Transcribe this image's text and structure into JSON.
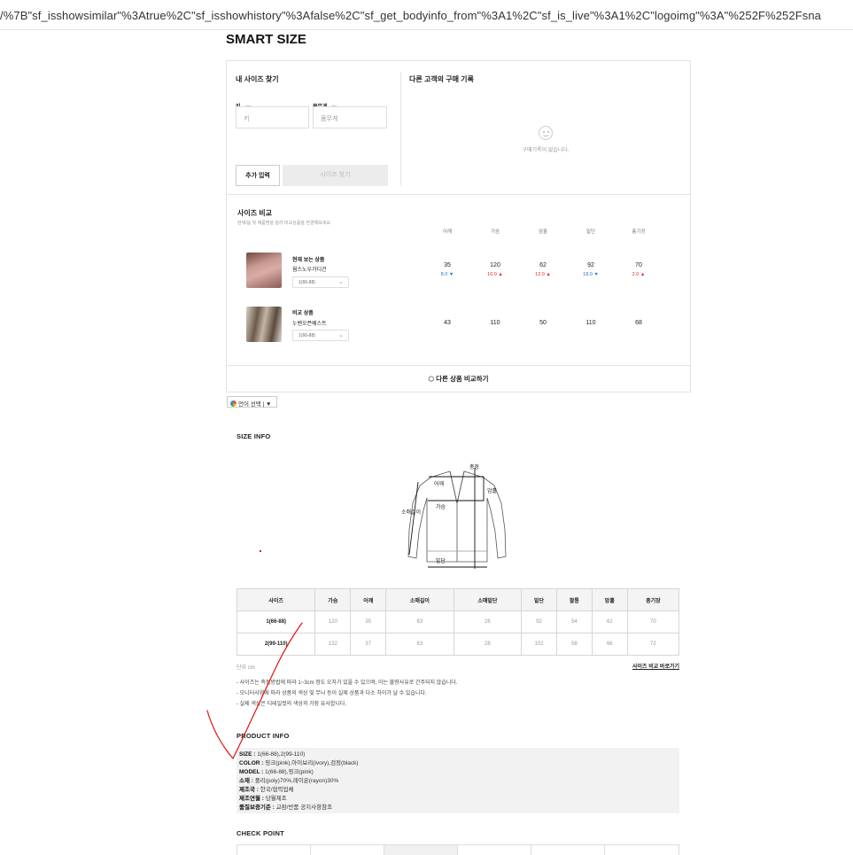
{
  "browser": {
    "url": "/%7B\"sf_isshowsimilar\"%3Atrue%2C\"sf_isshowhistory\"%3Afalse%2C\"sf_get_bodyinfo_from\"%3A1%2C\"sf_is_live\"%3A1%2C\"logoimg\"%3A\"%252F%252Fsna"
  },
  "page_title": "SMART SIZE",
  "find_size": {
    "heading": "내 사이즈 찾기",
    "height_label": "키",
    "height_unit": "cm",
    "weight_label": "몸무게",
    "weight_unit": "kg",
    "height_placeholder": "키",
    "weight_placeholder": "몸무게",
    "extra_button": "추가 입력",
    "find_button": "사이즈 찾기"
  },
  "history": {
    "heading": "다른 고객의 구매 기록",
    "empty_text": "구매기록이 없습니다."
  },
  "compare": {
    "heading": "사이즈 비교",
    "subtext": "현재/옵 및 제품명을 눌러 비교상품을 변경해보세요.",
    "columns": [
      "어깨",
      "가슴",
      "암홀",
      "밑단",
      "총기장"
    ],
    "current": {
      "tag": "현재 보는 상품",
      "name": "웜스노우가디건",
      "option": "1(66-88)",
      "values": [
        "35",
        "120",
        "62",
        "92",
        "70"
      ],
      "diffs": [
        "8.0",
        "10.0",
        "12.0",
        "18.0",
        "2.0"
      ],
      "diff_dir": [
        "down",
        "up",
        "up",
        "down",
        "up"
      ]
    },
    "other": {
      "tag": "비교 상품",
      "name": "누벤오픈베스트",
      "option": "1(66-88)",
      "values": [
        "43",
        "110",
        "50",
        "110",
        "68"
      ]
    },
    "compare_other_button": "다른 상품 비교하기"
  },
  "language": {
    "label": "언어 선택",
    "arrow": "▼"
  },
  "size_info": {
    "heading": "SIZE INFO",
    "diagram_labels": {
      "total_length": "총장",
      "shoulder": "어깨",
      "armhole": "암홀",
      "sleeve": "소매길이",
      "chest": "가슴",
      "hem": "밑단"
    },
    "table_headers": [
      "사이즈",
      "가슴",
      "어깨",
      "소매길이",
      "소매밑단",
      "밑단",
      "팔통",
      "암홀",
      "총기장"
    ],
    "rows": [
      [
        "1(66-88)",
        "120",
        "35",
        "63",
        "26",
        "92",
        "54",
        "62",
        "70"
      ],
      [
        "2(99-110)",
        "132",
        "37",
        "63",
        "28",
        "102",
        "58",
        "66",
        "72"
      ]
    ],
    "unit": "단위 cm",
    "compare_link": "사이즈 비교 바로가기",
    "notes": [
      "- 사이즈는 측정방법에 따라 1~3cm 정도 오차가 있을 수 있으며, 이는 불량사유로 간주되지 않습니다.",
      "- 모니터사양에 따라 상품의 색상 및 무늬 등이 실제 상품과 다소 차이가 날 수 있습니다.",
      "- 실제 색상은 디테일컷의 색상과 가장 유사합니다."
    ]
  },
  "product_info": {
    "heading": "PRODUCT INFO",
    "lines": [
      {
        "label": "SIZE :",
        "value": "1(66-88),2(99-110)"
      },
      {
        "label": "COLOR :",
        "value": "핑크(pink),아이보리(ivory),검정(black)"
      },
      {
        "label": "MODEL :",
        "value": "1(66-88),핑크(pink)"
      },
      {
        "label": "소재 :",
        "value": "폴리(poly)70%,레이온(rayon)30%"
      },
      {
        "label": "제조국 :",
        "value": "한국/협력업체"
      },
      {
        "label": "제조연월 :",
        "value": "당월제조"
      },
      {
        "label": "품질보증기준 :",
        "value": "교환/반품 공지사항참조"
      }
    ]
  },
  "check_point": {
    "heading": "CHECK POINT"
  },
  "colors": {
    "accent_red": "#e02b2b",
    "accent_blue": "#2f6fd1",
    "annotation_red": "#e0201a"
  }
}
